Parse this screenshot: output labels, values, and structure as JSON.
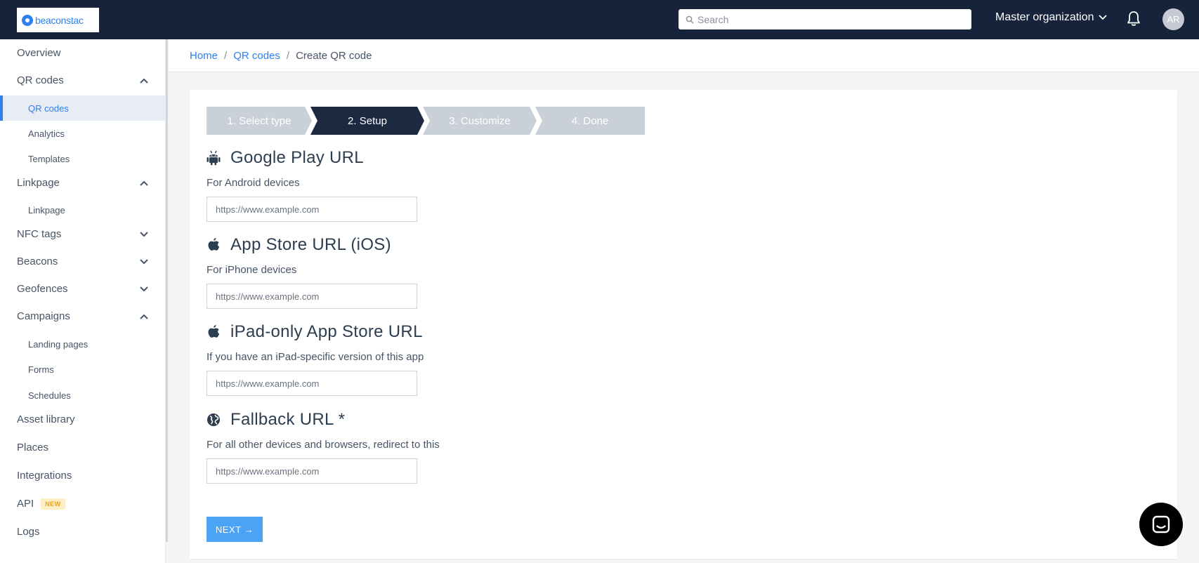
{
  "topbar": {
    "logo_text": "beaconstac",
    "search_placeholder": "Search",
    "org_label": "Master organization",
    "avatar_initials": "AR"
  },
  "sidebar": {
    "items": [
      {
        "label": "Overview"
      },
      {
        "label": "QR codes",
        "expanded": true
      },
      {
        "label": "QR codes",
        "sub": true,
        "active": true
      },
      {
        "label": "Analytics",
        "sub": true
      },
      {
        "label": "Templates",
        "sub": true
      },
      {
        "label": "Linkpage",
        "expanded": true
      },
      {
        "label": "Linkpage",
        "sub": true
      },
      {
        "label": "NFC tags",
        "expanded": false
      },
      {
        "label": "Beacons",
        "expanded": false
      },
      {
        "label": "Geofences",
        "expanded": false
      },
      {
        "label": "Campaigns",
        "expanded": true
      },
      {
        "label": "Landing pages",
        "sub": true
      },
      {
        "label": "Forms",
        "sub": true
      },
      {
        "label": "Schedules",
        "sub": true
      },
      {
        "label": "Asset library"
      },
      {
        "label": "Places"
      },
      {
        "label": "Integrations"
      },
      {
        "label": "API",
        "badge": "NEW"
      },
      {
        "label": "Logs"
      }
    ]
  },
  "breadcrumb": {
    "home": "Home",
    "qr_codes": "QR codes",
    "current": "Create QR code"
  },
  "stepper": {
    "steps": [
      "1. Select type",
      "2. Setup",
      "3. Customize",
      "4. Done"
    ],
    "active_index": 1
  },
  "fields": [
    {
      "title": "Google Play URL",
      "subtitle": "For Android devices",
      "placeholder": "https://www.example.com",
      "icon": "android-icon"
    },
    {
      "title": "App Store URL (iOS)",
      "subtitle": "For iPhone devices",
      "placeholder": "https://www.example.com",
      "icon": "apple-icon"
    },
    {
      "title": "iPad-only App Store URL",
      "subtitle": "If you have an iPad-specific version of this app",
      "placeholder": "https://www.example.com",
      "icon": "apple-icon"
    },
    {
      "title": "Fallback URL *",
      "subtitle": "For all other devices and browsers, redirect to this",
      "placeholder": "https://www.example.com",
      "icon": "globe-icon"
    }
  ],
  "next_button": {
    "label": "NEXT",
    "arrow": "→"
  },
  "colors": {
    "topbar": "#17223b",
    "accent": "#2f80ed",
    "button": "#4aa3f5",
    "step_active": "#1c2940",
    "step_inactive": "#c9d0d8"
  }
}
